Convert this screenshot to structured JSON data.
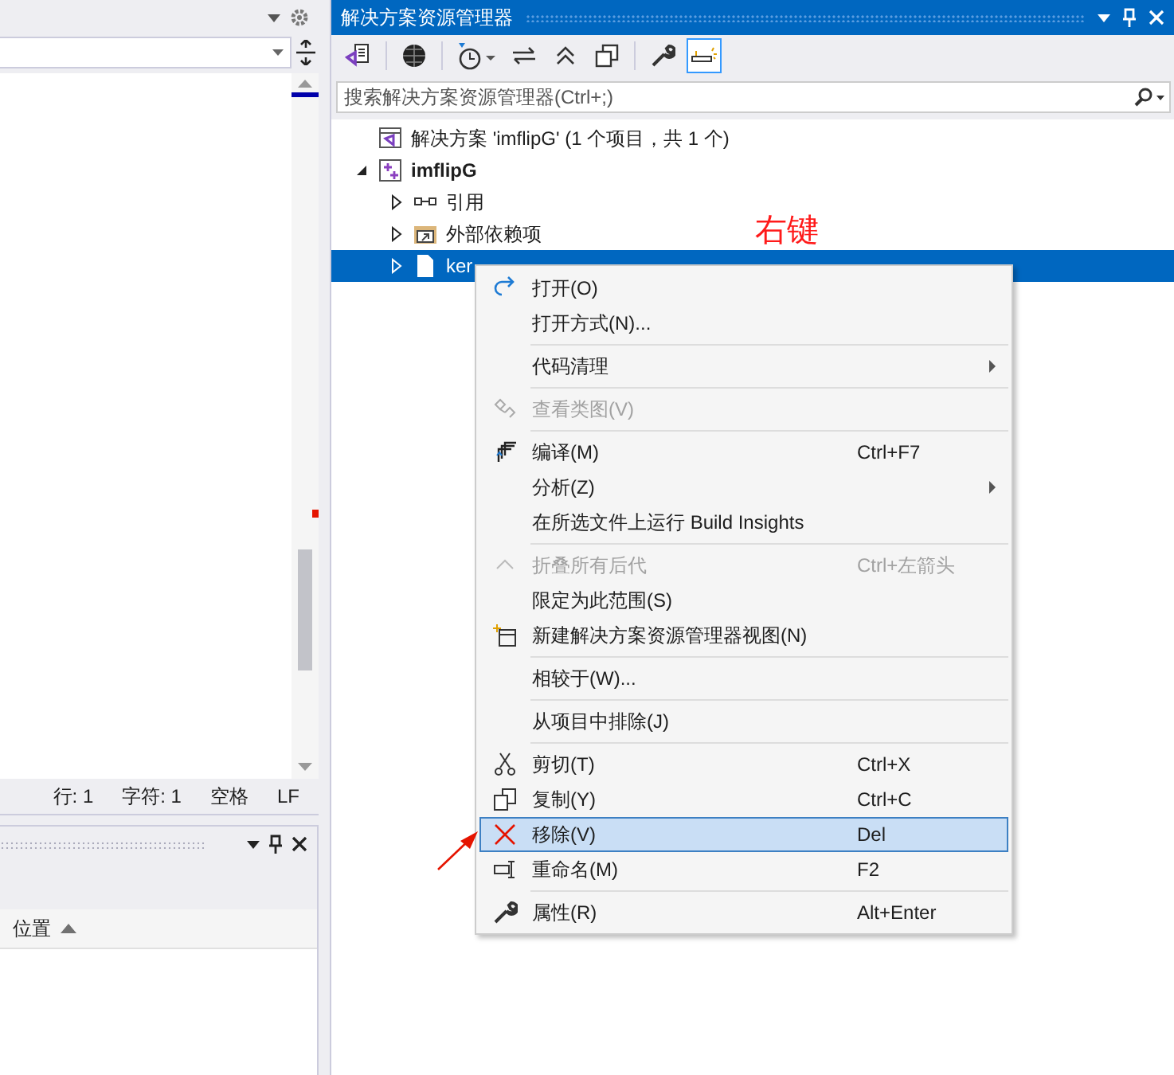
{
  "editor": {
    "status_bar": [
      "行: 1",
      "字符: 1",
      "空格",
      "LF"
    ]
  },
  "bottom_panel": {
    "columns": [
      {
        "label": "位置",
        "sort_ascending": true
      }
    ]
  },
  "solution_explorer": {
    "title": "解决方案资源管理器",
    "search": {
      "placeholder": "搜索解决方案资源管理器(Ctrl+;)"
    },
    "tree": [
      {
        "label": "解决方案 'imflipG' (1 个项目，共 1 个)",
        "bold": false,
        "selected": false,
        "children": [
          {
            "label": "imflipG",
            "bold": true,
            "expanded": true,
            "selected": false,
            "children": [
              {
                "label": "引用",
                "bold": false,
                "expanded": false,
                "selected": false
              },
              {
                "label": "外部依赖项",
                "bold": false,
                "expanded": false,
                "selected": false
              },
              {
                "label": "ker",
                "bold": false,
                "expanded": false,
                "selected": true
              }
            ]
          }
        ]
      }
    ]
  },
  "context_menu": {
    "items": [
      {
        "kind": "item",
        "label": "打开(O)",
        "disabled": false,
        "selected": false,
        "submenu": false
      },
      {
        "kind": "item",
        "label": "打开方式(N)...",
        "disabled": false,
        "selected": false,
        "submenu": false
      },
      {
        "kind": "separator"
      },
      {
        "kind": "item",
        "label": "代码清理",
        "disabled": false,
        "selected": false,
        "submenu": true
      },
      {
        "kind": "separator"
      },
      {
        "kind": "item",
        "label": "查看类图(V)",
        "disabled": true,
        "selected": false,
        "submenu": false
      },
      {
        "kind": "separator"
      },
      {
        "kind": "item",
        "label": "编译(M)",
        "shortcut": "Ctrl+F7",
        "disabled": false,
        "selected": false,
        "submenu": false
      },
      {
        "kind": "item",
        "label": "分析(Z)",
        "disabled": false,
        "selected": false,
        "submenu": true
      },
      {
        "kind": "item",
        "label": "在所选文件上运行 Build Insights",
        "disabled": false,
        "selected": false,
        "submenu": false
      },
      {
        "kind": "separator"
      },
      {
        "kind": "item",
        "label": "折叠所有后代",
        "shortcut": "Ctrl+左箭头",
        "disabled": true,
        "selected": false,
        "submenu": false
      },
      {
        "kind": "item",
        "label": "限定为此范围(S)",
        "disabled": false,
        "selected": false,
        "submenu": false
      },
      {
        "kind": "item",
        "label": "新建解决方案资源管理器视图(N)",
        "disabled": false,
        "selected": false,
        "submenu": false
      },
      {
        "kind": "separator"
      },
      {
        "kind": "item",
        "label": "相较于(W)...",
        "disabled": false,
        "selected": false,
        "submenu": false
      },
      {
        "kind": "separator"
      },
      {
        "kind": "item",
        "label": "从项目中排除(J)",
        "disabled": false,
        "selected": false,
        "submenu": false
      },
      {
        "kind": "separator"
      },
      {
        "kind": "item",
        "label": "剪切(T)",
        "shortcut": "Ctrl+X",
        "disabled": false,
        "selected": false,
        "submenu": false
      },
      {
        "kind": "item",
        "label": "复制(Y)",
        "shortcut": "Ctrl+C",
        "disabled": false,
        "selected": false,
        "submenu": false
      },
      {
        "kind": "item",
        "label": "移除(V)",
        "shortcut": "Del",
        "disabled": false,
        "selected": true,
        "submenu": false
      },
      {
        "kind": "item",
        "label": "重命名(M)",
        "shortcut": "F2",
        "disabled": false,
        "selected": false,
        "submenu": false
      },
      {
        "kind": "separator"
      },
      {
        "kind": "item",
        "label": "属性(R)",
        "shortcut": "Alt+Enter",
        "disabled": false,
        "selected": false,
        "submenu": false
      }
    ]
  },
  "annotation": {
    "text": "右键"
  }
}
